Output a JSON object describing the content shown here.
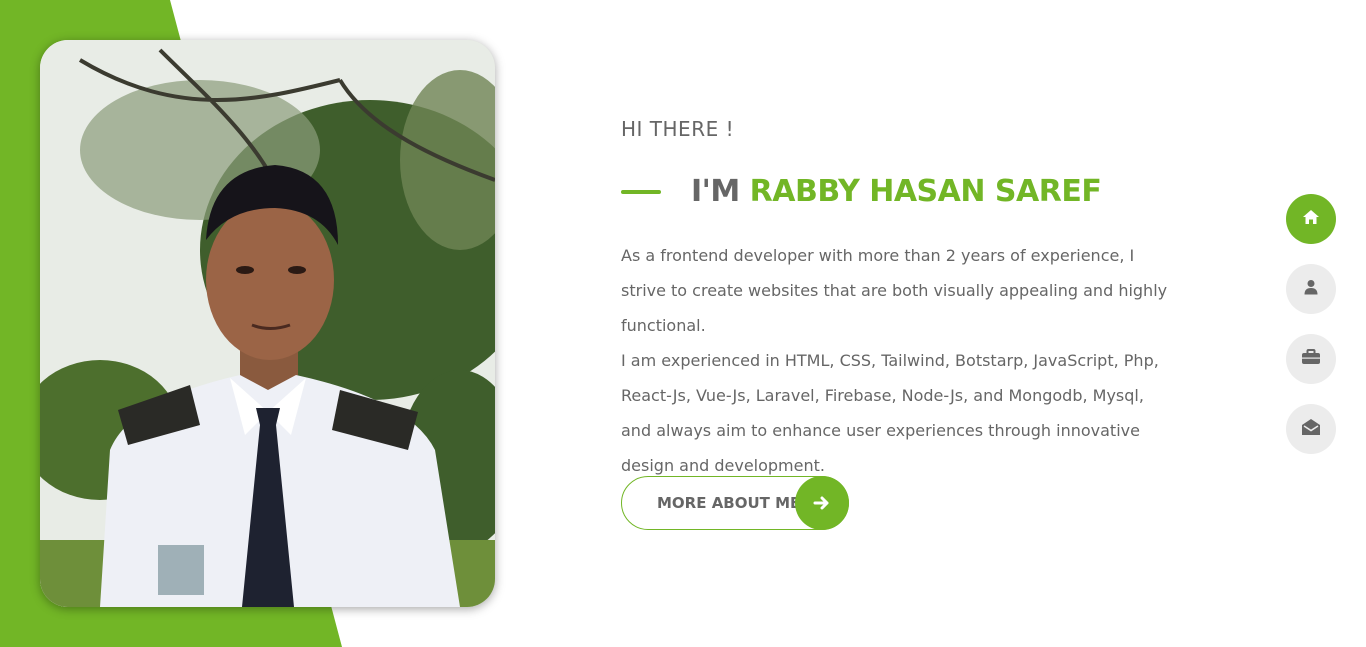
{
  "colors": {
    "accent": "#72b626",
    "text": "#666666",
    "nav_inactive": "#ececec"
  },
  "profile_photo": {
    "icon": "person-photo"
  },
  "intro": {
    "greeting": "HI THERE !",
    "name_prefix": "I'M",
    "name": "RABBY HASAN SAREF",
    "bio_line1": "As a frontend developer with more than 2 years of experience, I strive to create websites that are both visually appealing and highly functional.",
    "bio_line2": "I am experienced in HTML, CSS, Tailwind, Botstarp, JavaScript, Php, React-Js, Vue-Js, Laravel, Firebase, Node-Js, and Mongodb, Mysql, and always aim to enhance user experiences through innovative design and development.",
    "more_button_label": "MORE ABOUT ME",
    "more_button_icon": "arrow-right-icon"
  },
  "side_nav": [
    {
      "icon": "home-icon",
      "active": true
    },
    {
      "icon": "user-icon",
      "active": false
    },
    {
      "icon": "briefcase-icon",
      "active": false
    },
    {
      "icon": "envelope-open-icon",
      "active": false
    }
  ]
}
